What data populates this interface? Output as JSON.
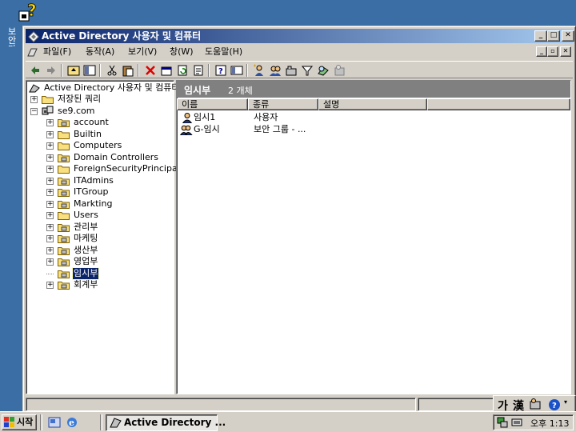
{
  "desktop": {
    "icon_label": "보안 마"
  },
  "window": {
    "title": "Active Directory 사용자 및 컴퓨터"
  },
  "menu": [
    "파일(F)",
    "동작(A)",
    "보기(V)",
    "창(W)",
    "도움말(H)"
  ],
  "tree": {
    "root": "Active Directory 사용자 및 컴퓨터",
    "saved_queries": "저장된 쿼리",
    "domain": "se9.com",
    "children": [
      "account",
      "Builtin",
      "Computers",
      "Domain Controllers",
      "ForeignSecurityPrincipals",
      "ITAdmins",
      "ITGroup",
      "Markting",
      "Users",
      "관리부",
      "마케팅",
      "생산부",
      "영업부",
      "임시부",
      "회계부"
    ],
    "selected": "임시부"
  },
  "details": {
    "title": "임시부",
    "count": "2 개체",
    "columns": [
      "이름",
      "종류",
      "설명"
    ],
    "rows": [
      {
        "name": "임시1",
        "type": "사용자",
        "desc": ""
      },
      {
        "name": "G-임시",
        "type": "보안 그룹 - ...",
        "desc": ""
      }
    ]
  },
  "ime": {
    "hangul": "가",
    "hanja": "漢"
  },
  "taskbar": {
    "start": "시작",
    "task": "Active Directory ...",
    "clock": "오후 1:13"
  },
  "colors": {
    "title_start": "#0a246a",
    "title_end": "#a6caf0",
    "desktop": "#3a6ea5",
    "selection": "#0a246a"
  }
}
